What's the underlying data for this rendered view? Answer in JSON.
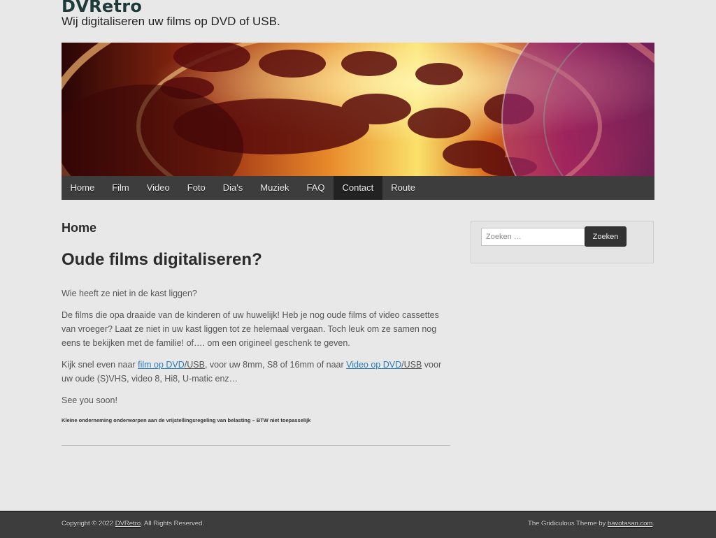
{
  "site": {
    "title": "DVRetro",
    "description": "Wij digitaliseren uw films op DVD of USB."
  },
  "nav": {
    "items": [
      "Home",
      "Film",
      "Video",
      "Foto",
      "Dia's",
      "Muziek",
      "FAQ",
      "Contact",
      "Route"
    ],
    "active": "Contact"
  },
  "content": {
    "page_title": "Home",
    "post_title": "Oude films digitaliseren?",
    "p1": "Wie heeft ze niet in de kast liggen?",
    "p2": "De films die opa draaide van de kinderen of uw huwelijk! Heb je nog oude films of video cassettes van vroeger? Laat ze niet in uw kast liggen tot ze helemaal vergaan. Toch leuk om ze samen nog eens te bekijken met de familie! of…. om een origineel geschenk te geven.",
    "p3": {
      "before": "Kijk snel even naar ",
      "link1_a": "film op DVD",
      "link1_b": "/USB",
      "middle": ", voor uw 8mm, S8 of 16mm of naar ",
      "link2_a": "Video op DVD",
      "link2_b": "/USB",
      "after": " voor uw oude (S)VHS, video 8, Hi8, U-matic enz…"
    },
    "p4": "See you soon!",
    "small_note": "Kleine onderneming onderworpen aan de vrijstellingsregeling van belasting – BTW niet toepasselijk"
  },
  "sidebar": {
    "search_placeholder": "Zoeken …",
    "search_value": "",
    "search_button": "Zoeken"
  },
  "footer": {
    "left_prefix": "Copyright © 2022 ",
    "left_link": "DVRetro",
    "left_suffix": ". All Rights Reserved.",
    "right_prefix": "The Gridiculous Theme by ",
    "right_link": "bavotasan.com",
    "right_suffix": "."
  },
  "colors": {
    "background": "#e8e8e8",
    "nav_bg": "#3d3d3d",
    "nav_active_bg": "#222222",
    "link": "#2b7bb9",
    "footer_bg": "#3d3d3d"
  },
  "header_image": {
    "icon": "film-reel-banner"
  }
}
